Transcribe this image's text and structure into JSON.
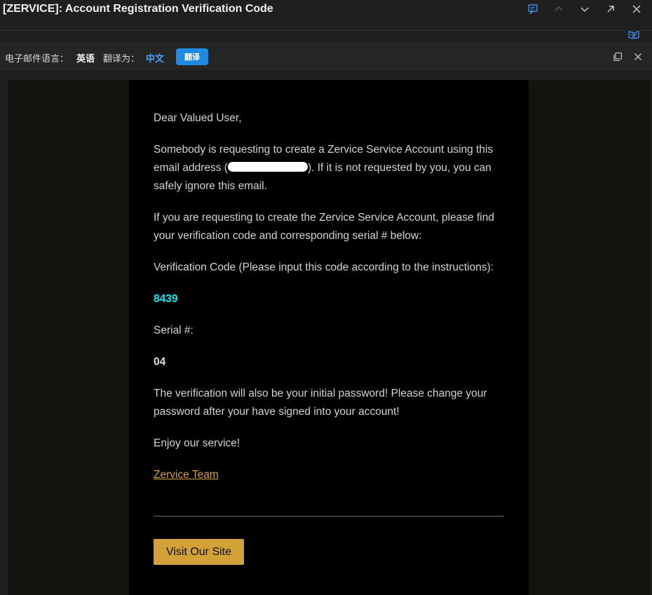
{
  "window": {
    "subject": "[ZERVICE]: Account Registration Verification Code"
  },
  "translate_bar": {
    "email_language_label": "电子邮件语言：",
    "email_language_value": "英语",
    "translate_to_label": "翻译为：",
    "translate_to_value": "中文",
    "translate_button": "翻译"
  },
  "email": {
    "greeting": "Dear Valued User,",
    "para1_before": "Somebody is requesting to create a Zervice Service Account using this email address (",
    "para1_after": "). If it is not requested by you, you can safely ignore this email.",
    "para2": "If you are requesting to create the Zervice Service Account, please find your verification code and corresponding serial # below:",
    "code_label": "Verification Code (Please input this code according to the instructions):",
    "code_value": "8439",
    "serial_label": "Serial #:",
    "serial_value": "04",
    "para3": "The verification will also be your initial password! Please change your password after your have signed into your account!",
    "closing": "Enjoy our service!",
    "signature_link": "Zervice Team",
    "visit_button": "Visit Our Site"
  },
  "colors": {
    "code": "#00f0f5",
    "link": "#d4a245",
    "button_bg": "#d2a138",
    "translate_button_bg": "#1e8be0",
    "accent_blue": "#4aa3ff"
  },
  "icons": [
    "reply-comment-icon",
    "chevron-up-icon",
    "chevron-down-icon",
    "open-external-icon",
    "close-icon",
    "immersive-reader-icon",
    "copy-icon",
    "close-translate-icon"
  ]
}
